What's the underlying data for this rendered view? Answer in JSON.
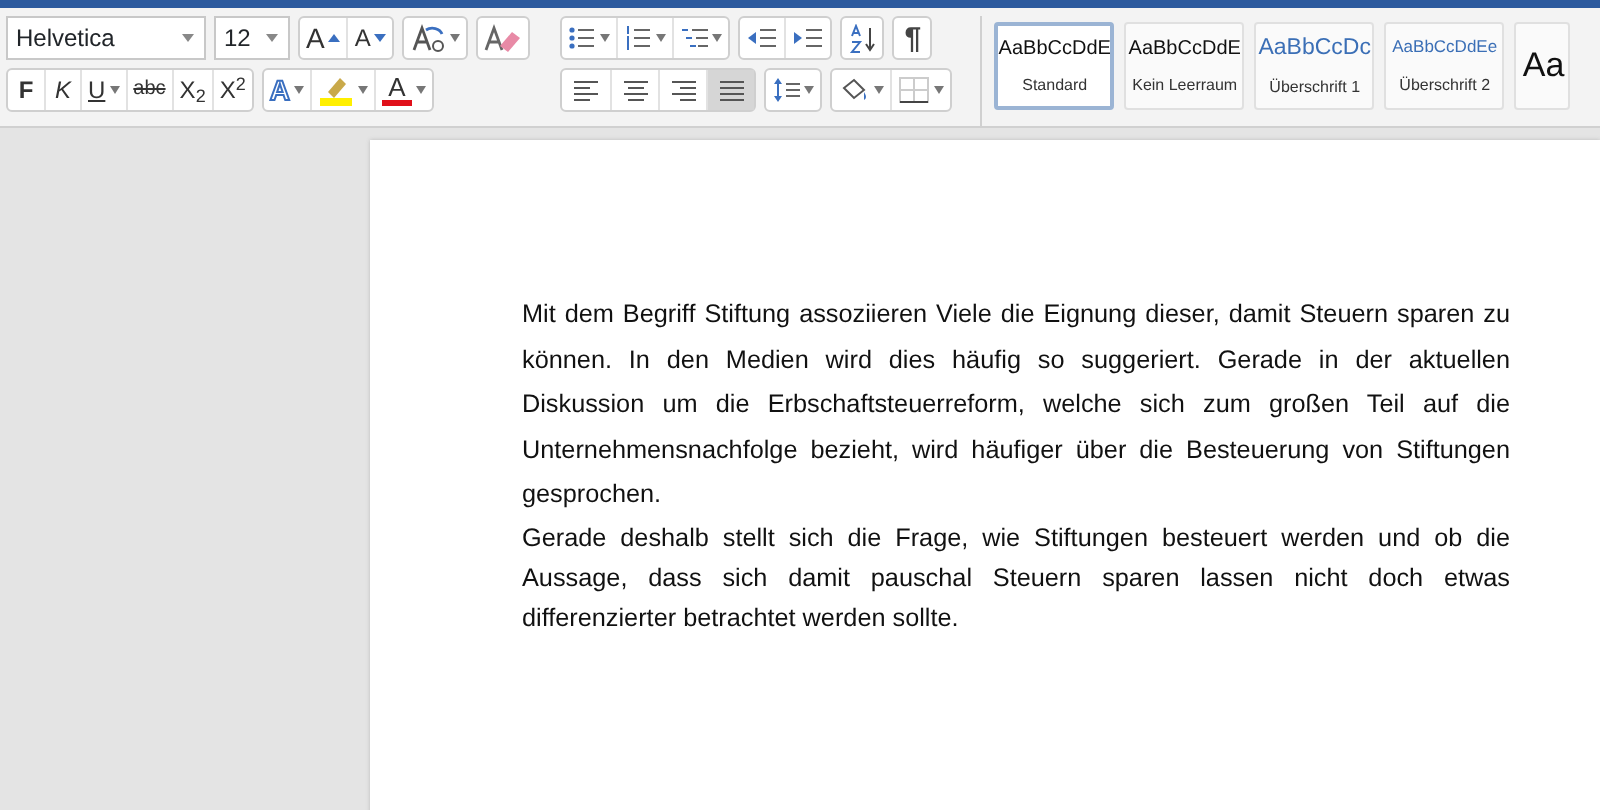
{
  "font": {
    "family": "Helvetica",
    "size": "12"
  },
  "size_buttons": [
    {
      "label": "A",
      "kind": "grow"
    },
    {
      "label": "A",
      "kind": "shrink"
    }
  ],
  "char_format": [
    {
      "label": "F",
      "kind": "bold"
    },
    {
      "label": "K",
      "kind": "italic"
    },
    {
      "label": "U",
      "kind": "underline"
    },
    {
      "label": "abc",
      "kind": "strike"
    },
    {
      "label": "X$_{2}$",
      "kind": "subscript"
    },
    {
      "label": "X$^{2}$",
      "kind": "superscript"
    }
  ],
  "text_effects": {
    "label": "A"
  },
  "font_color": {
    "label": "A",
    "color": "#e0101a"
  },
  "alignments": [
    {
      "kind": "left",
      "selected": false
    },
    {
      "kind": "center",
      "selected": false
    },
    {
      "kind": "right",
      "selected": false
    },
    {
      "kind": "justify",
      "selected": true
    }
  ],
  "pilcrow": {
    "label": "¶"
  },
  "styles": [
    {
      "sample": "AaBbCcDdE",
      "name": "Standard",
      "kind": "normal",
      "selected": true
    },
    {
      "sample": "AaBbCcDdE",
      "name": "Kein Leerraum",
      "kind": "normal",
      "selected": false
    },
    {
      "sample": "AaBbCcDc",
      "name": "Überschrift 1",
      "kind": "heading1",
      "selected": false
    },
    {
      "sample": "AaBbCcDdEe",
      "name": "Überschrift 2",
      "kind": "heading2",
      "selected": false
    },
    {
      "sample": "Aa",
      "kind": "title",
      "selected": false
    }
  ],
  "document": {
    "paragraphs": [
      "Mit dem Begriff Stiftung assoziieren Viele die Eignung dieser, damit Steuern sparen zu können. In den Medien wird dies häufig so suggeriert. Gerade in der aktuellen Diskussion um die Erbschaftsteuerreform, welche sich zum großen Teil auf die Unternehmensnachfolge bezieht, wird häufiger über die Besteuerung von Stiftungen gesprochen.",
      "Gerade deshalb stellt sich die Frage, wie Stiftungen besteuert werden und ob die Aussage, dass sich damit pauschal Steuern sparen lassen nicht doch etwas differenzierter betrachtet werden sollte."
    ]
  }
}
